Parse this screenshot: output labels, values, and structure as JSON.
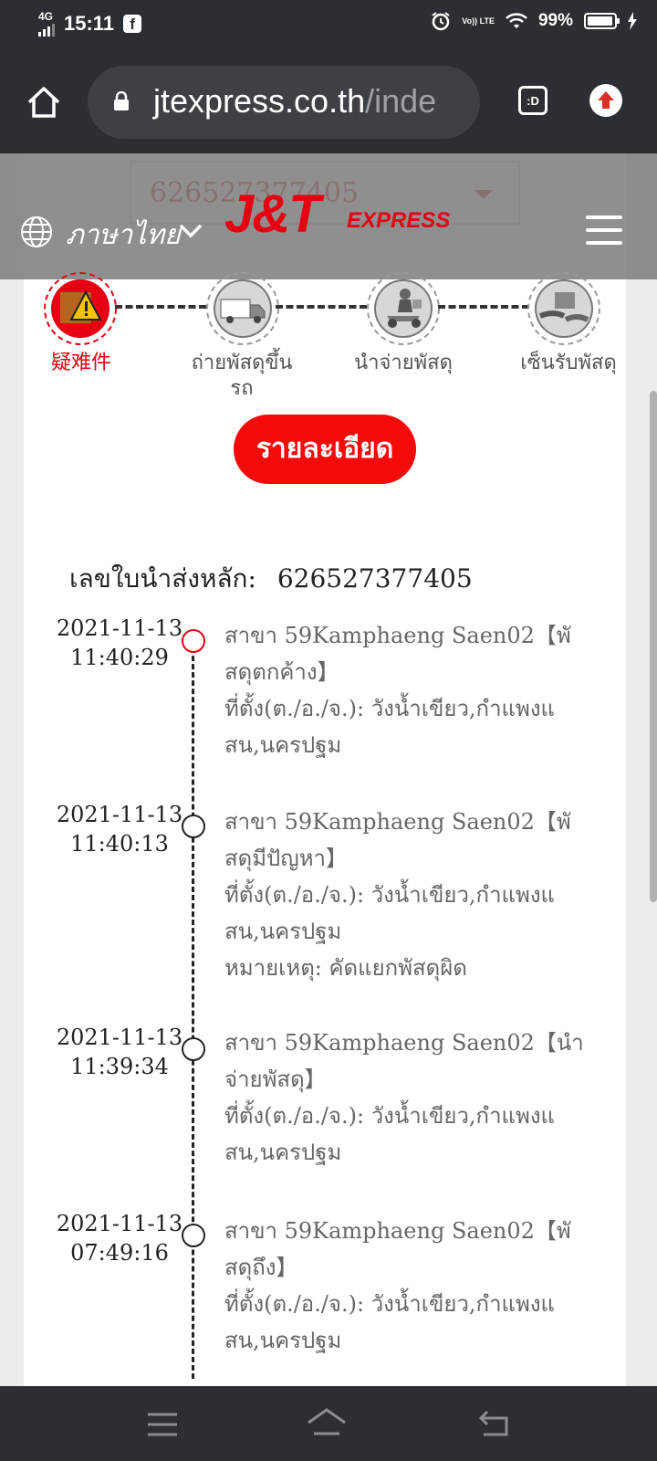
{
  "status_bar": {
    "network": "4G",
    "time": "15:11",
    "battery": "99%",
    "volte": "Vo)) LTE"
  },
  "browser": {
    "url_main": "jtexpress.co.th",
    "url_rest": "/inde",
    "tabs_label": ":D"
  },
  "header": {
    "language": "ภาษาไทย",
    "logo_main": "J&T",
    "logo_sub": "EXPRESS"
  },
  "waybill_select": {
    "value": "626527377405"
  },
  "steps": [
    {
      "label": "疑难件"
    },
    {
      "label": "ถ่ายพัสดุขึ้นรถ"
    },
    {
      "label": "นำจ่ายพัสดุ"
    },
    {
      "label": "เซ็นรับพัสดุ"
    }
  ],
  "detail_button": "รายละเอียด",
  "main_waybill": {
    "label": "เลขใบนำส่งหลัก:",
    "value": "626527377405"
  },
  "events": [
    {
      "date": "2021-11-13",
      "time": "11:40:29",
      "line1": "สาขา 59Kamphaeng Saen02【พั",
      "line2": "สดุตกค้าง】",
      "line3": "ที่ตั้ง(ต./อ./จ.):  วังน้ำเขียว,กำแพงแ",
      "line4": "สน,นครปฐม"
    },
    {
      "date": "2021-11-13",
      "time": "11:40:13",
      "line1": "สาขา 59Kamphaeng Saen02【พั",
      "line2": "สดุมีปัญหา】",
      "line3": "ที่ตั้ง(ต./อ./จ.):  วังน้ำเขียว,กำแพงแ",
      "line4": "สน,นครปฐม",
      "line5": "หมายเหตุ:  คัดแยกพัสดุผิด"
    },
    {
      "date": "2021-11-13",
      "time": "11:39:34",
      "line1": "สาขา 59Kamphaeng Saen02【นำ",
      "line2": "จ่ายพัสดุ】",
      "line3": "ที่ตั้ง(ต./อ./จ.):  วังน้ำเขียว,กำแพงแ",
      "line4": "สน,นครปฐม"
    },
    {
      "date": "2021-11-13",
      "time": "07:49:16",
      "line1": "สาขา 59Kamphaeng Saen02【พั",
      "line2": "สดุถึง】",
      "line3": "ที่ตั้ง(ต./อ./จ.):  วังน้ำเขียว,กำแพงแ",
      "line4": "สน,นครปฐม"
    }
  ],
  "colors": {
    "brand_red": "#e60012",
    "dark_bar": "#2b2e32"
  }
}
